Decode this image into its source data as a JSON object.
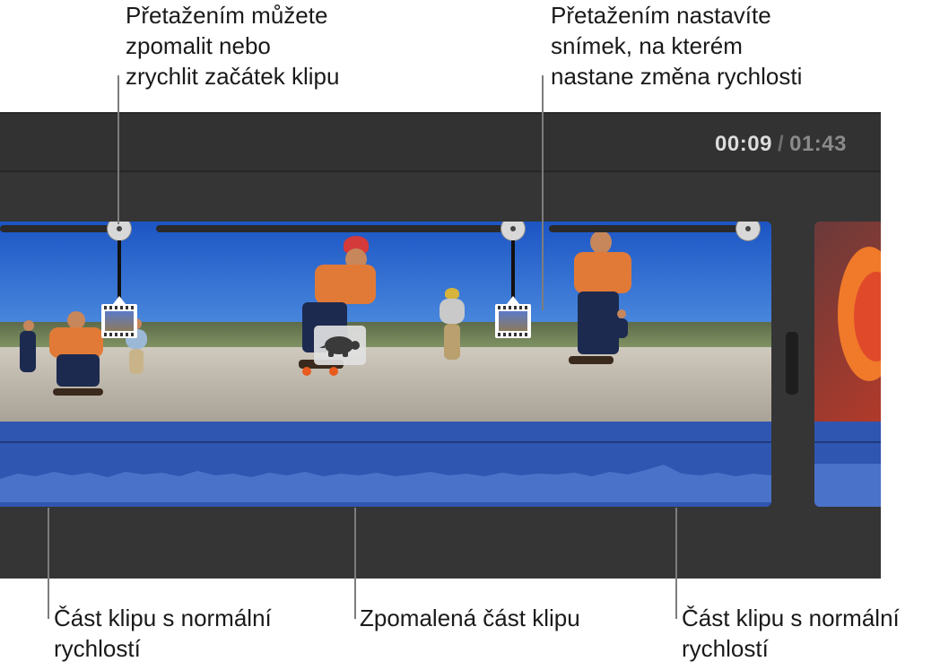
{
  "callouts": {
    "top_left": "Přetažením můžete\nzpomalit nebo\nzrychlit začátek klipu",
    "top_right": "Přetažením nastavíte\nsnímek, na kterém\nnastane změna rychlosti",
    "bottom_left": "Část klipu s normální\nrychlostí",
    "bottom_middle": "Zpomalená část klipu",
    "bottom_right": "Část klipu s normální\nrychlostí"
  },
  "timecode": {
    "current": "00:09",
    "separator": "/",
    "total": "01:43"
  },
  "clip": {
    "speed_badge_icon": "turtle-icon",
    "segments": [
      "normal-speed",
      "slow-motion",
      "normal-speed"
    ]
  },
  "colors": {
    "timeline_bg": "#353535",
    "clip_audio_blue": "#2f56b0",
    "callout_line": "#7d7d7d"
  }
}
